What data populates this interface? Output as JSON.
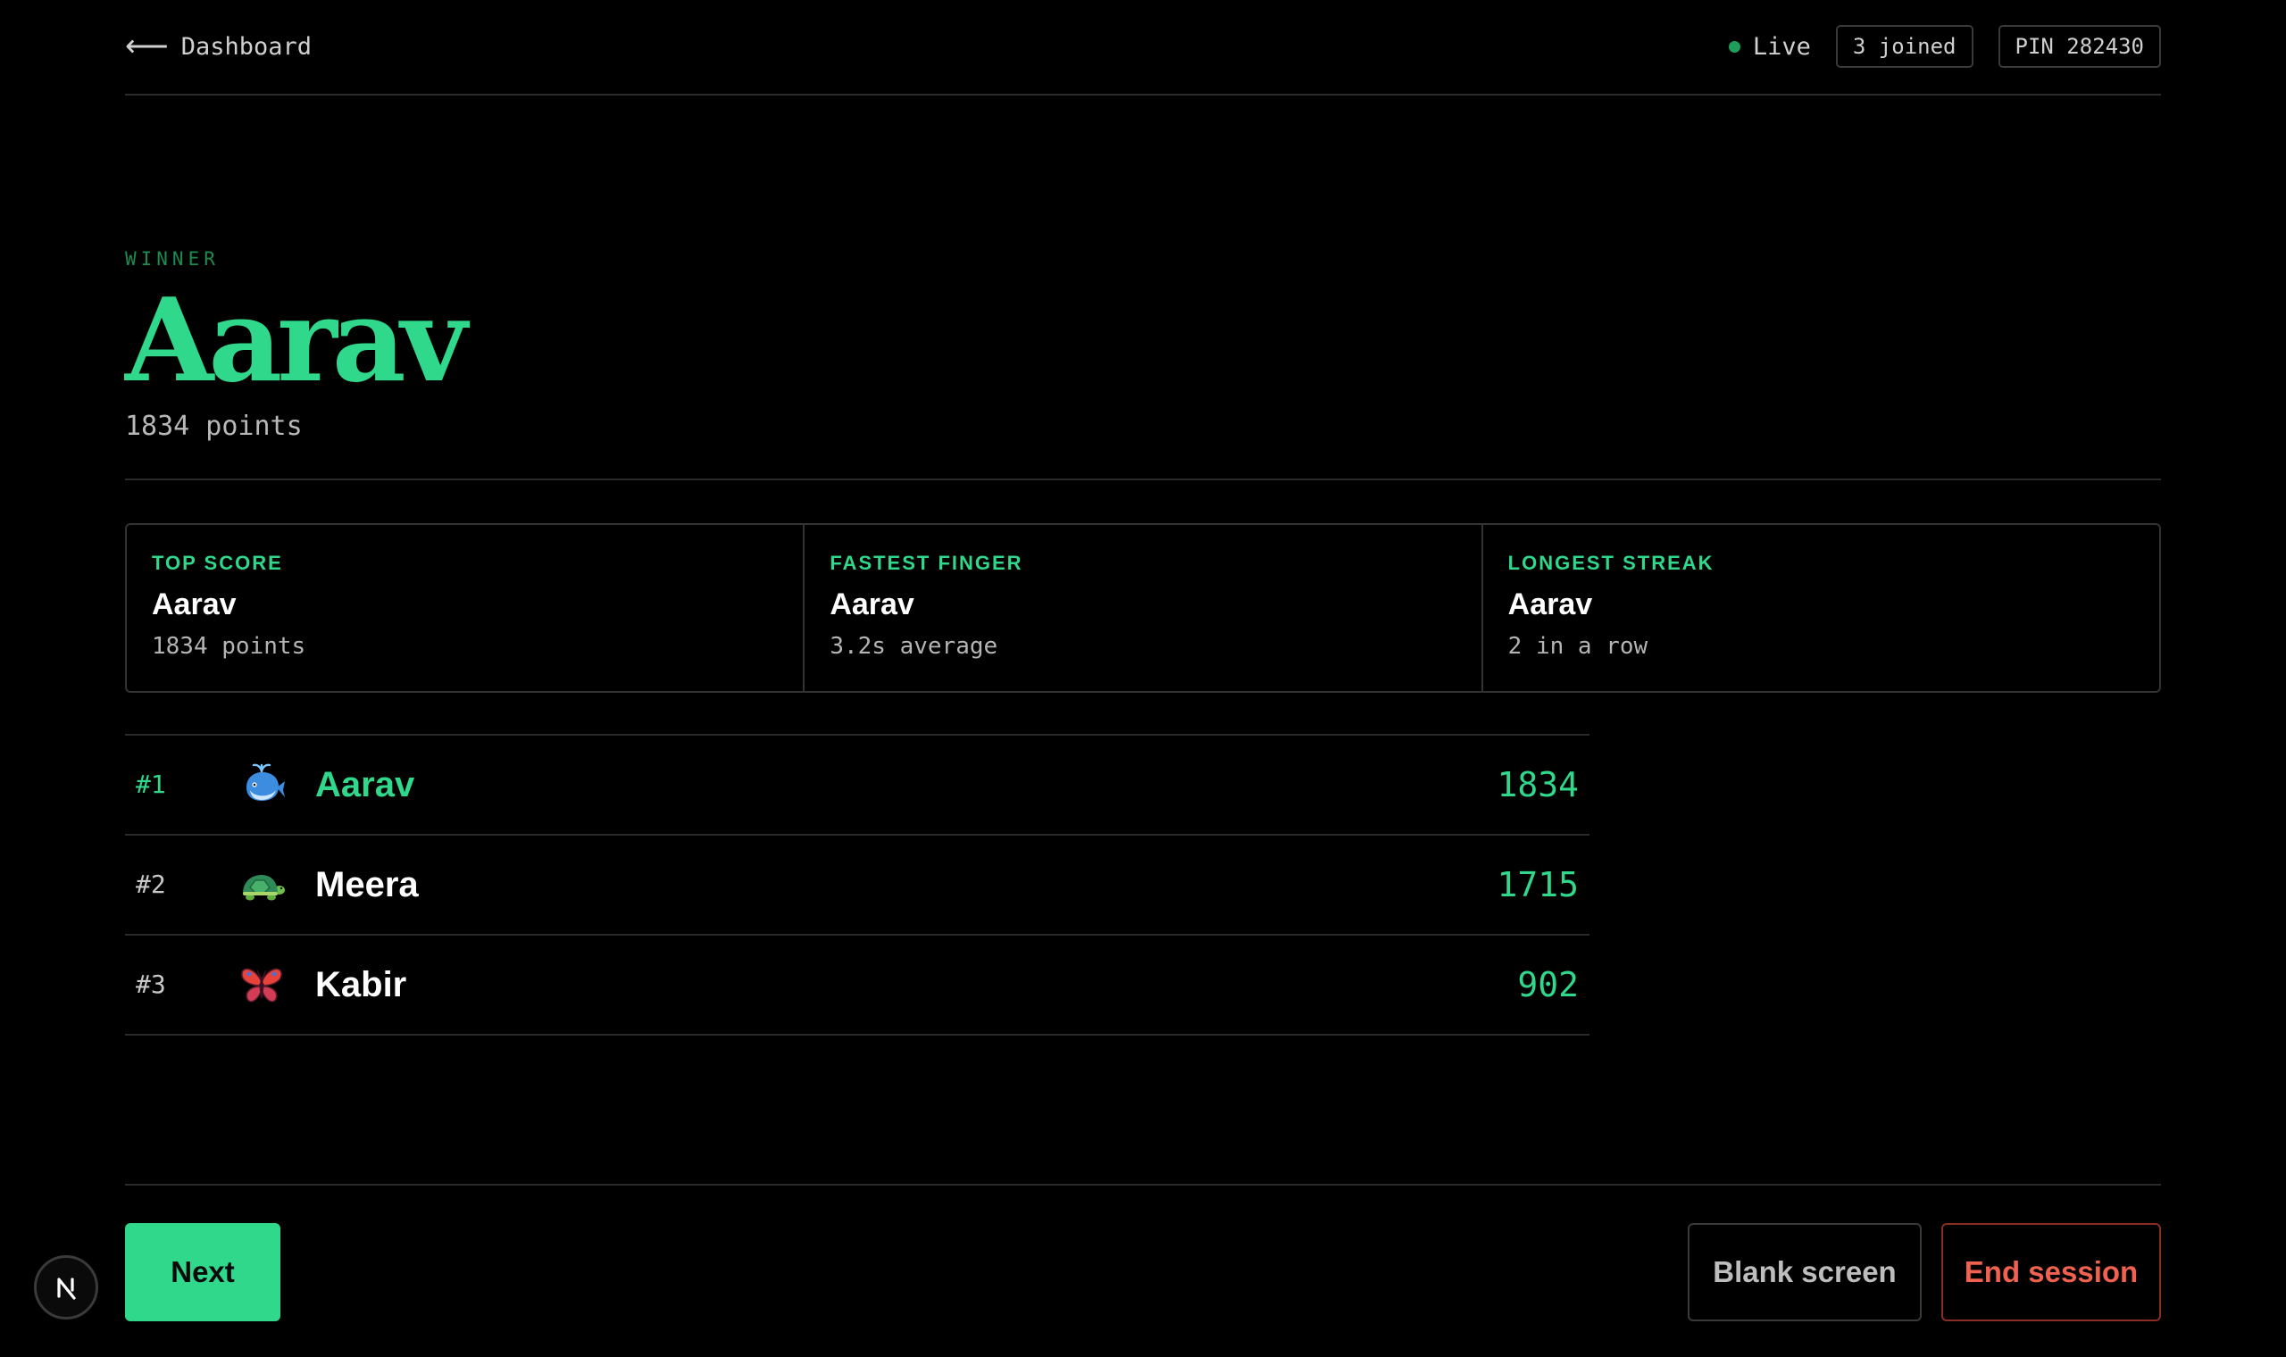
{
  "header": {
    "back_label": "Dashboard",
    "live_label": "Live",
    "joined_chip": "3 joined",
    "pin_chip": "PIN 282430"
  },
  "winner": {
    "label": "WINNER",
    "name": "Aarav",
    "points": "1834 points"
  },
  "stats": [
    {
      "label": "TOP SCORE",
      "name": "Aarav",
      "detail": "1834 points"
    },
    {
      "label": "FASTEST FINGER",
      "name": "Aarav",
      "detail": "3.2s average"
    },
    {
      "label": "LONGEST STREAK",
      "name": "Aarav",
      "detail": "2 in a row"
    }
  ],
  "leaderboard": [
    {
      "rank": "#1",
      "avatar": "whale-icon",
      "name": "Aarav",
      "score": "1834"
    },
    {
      "rank": "#2",
      "avatar": "turtle-icon",
      "name": "Meera",
      "score": "1715"
    },
    {
      "rank": "#3",
      "avatar": "butterfly-icon",
      "name": "Kabir",
      "score": "902"
    }
  ],
  "footer": {
    "next_label": "Next",
    "blank_label": "Blank screen",
    "end_label": "End session"
  },
  "colors": {
    "accent": "#2fd88a",
    "live_dot": "#1f9d5a",
    "danger": "#f0614f",
    "background": "#000000"
  }
}
